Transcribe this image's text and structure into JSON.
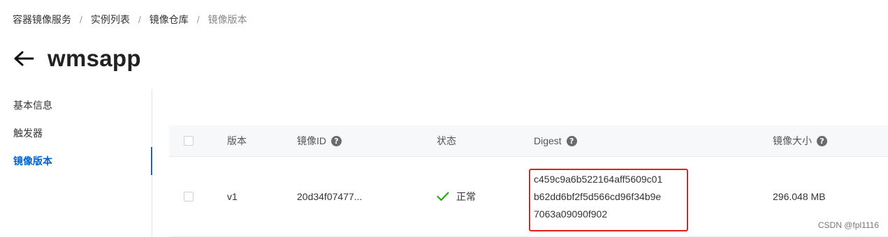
{
  "breadcrumb": {
    "items": [
      "容器镜像服务",
      "实例列表",
      "镜像仓库",
      "镜像版本"
    ],
    "separator": "/"
  },
  "title": "wmsapp",
  "sidebar": {
    "items": [
      {
        "label": "基本信息",
        "active": false
      },
      {
        "label": "触发器",
        "active": false
      },
      {
        "label": "镜像版本",
        "active": true
      }
    ]
  },
  "table": {
    "headers": {
      "version": "版本",
      "image_id": "镜像ID",
      "status": "状态",
      "digest": "Digest",
      "size": "镜像大小"
    },
    "rows": [
      {
        "version": "v1",
        "image_id": "20d34f07477...",
        "status": "正常",
        "digest_lines": [
          "c459c9a6b522164aff5609c01",
          "b62dd6bf2f5d566cd96f34b9e",
          "7063a09090f902"
        ],
        "size": "296.048 MB"
      }
    ]
  },
  "watermark": "CSDN @fpl1116",
  "colors": {
    "accent": "#0064c8",
    "highlight_border": "#e02020",
    "status_ok": "#2aa515"
  },
  "icons": {
    "back": "arrow-left-icon",
    "help": "question-circle-icon",
    "status": "checkmark-icon"
  }
}
